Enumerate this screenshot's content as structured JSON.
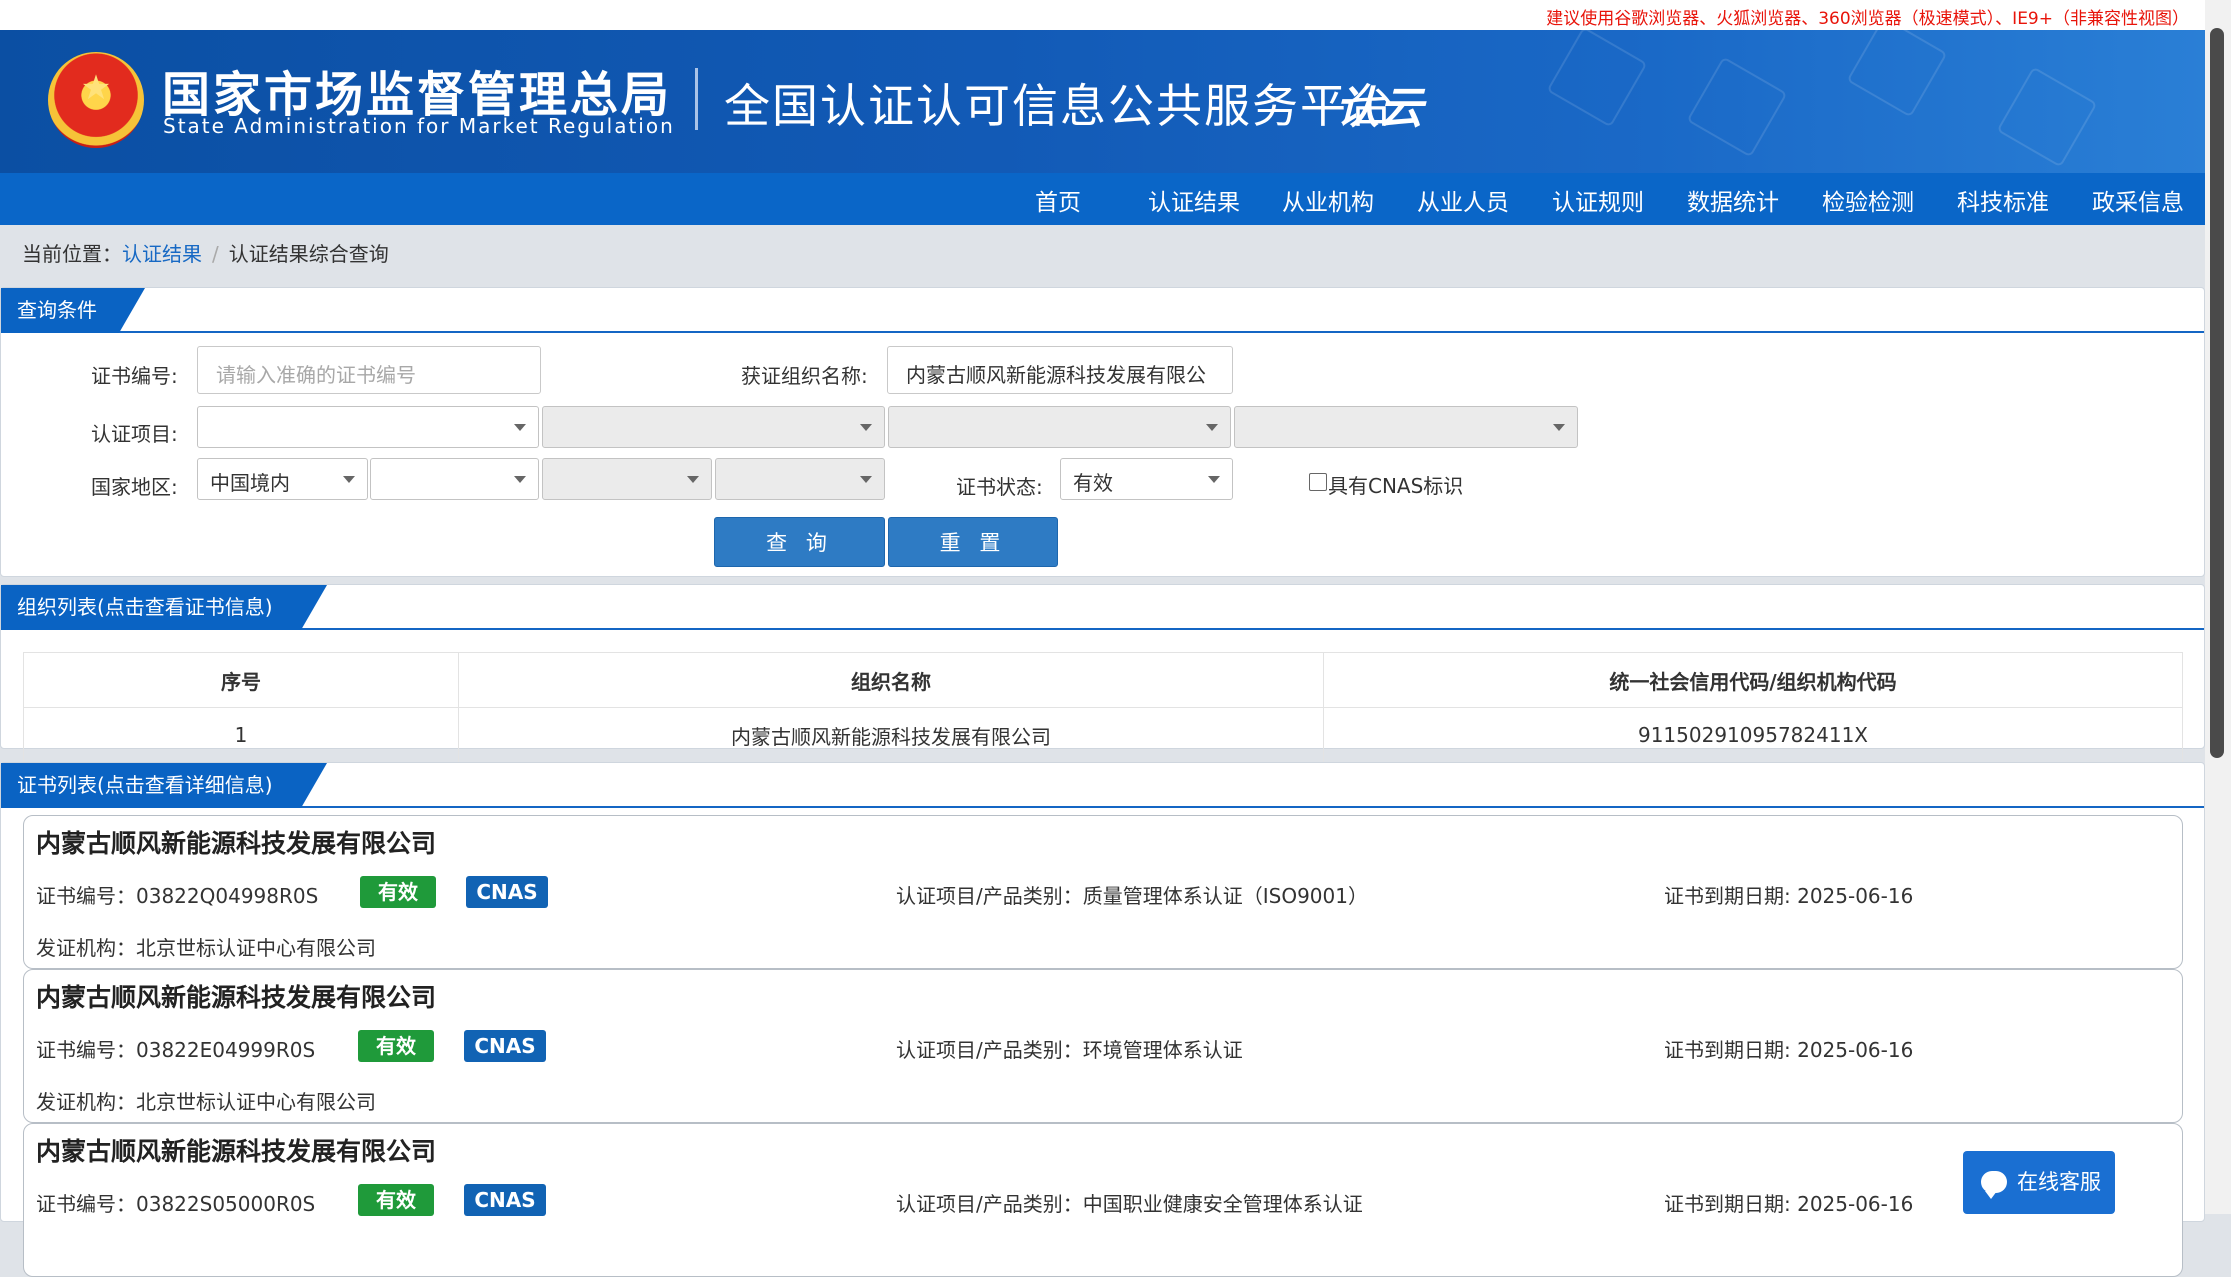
{
  "notice": "建议使用谷歌浏览器、火狐浏览器、360浏览器（极速模式）、IE9+（非兼容性视图）",
  "header": {
    "org_cn": "国家市场监督管理总局",
    "org_en": "State Administration for Market Regulation",
    "platform": "全国认证认可信息公共服务平台",
    "logo_text": "认云"
  },
  "nav": [
    "首页",
    "认证结果",
    "从业机构",
    "从业人员",
    "认证规则",
    "数据统计",
    "检验检测",
    "科技标准",
    "政采信息"
  ],
  "breadcrumb": {
    "prefix": "当前位置：",
    "link": "认证结果",
    "separator": "/",
    "current": "认证结果综合查询"
  },
  "query": {
    "title": "查询条件",
    "cert_no_label": "证书编号:",
    "cert_no_placeholder": "请输入准确的证书编号",
    "org_name_label": "获证组织名称:",
    "org_name_value": "内蒙古顺风新能源科技发展有限公",
    "project_label": "认证项目:",
    "region_label": "国家地区:",
    "region_value": "中国境内",
    "status_label": "证书状态:",
    "status_value": "有效",
    "cnas_checkbox_label": "具有CNAS标识",
    "search_button": "查 询",
    "reset_button": "重 置"
  },
  "org_list": {
    "title": "组织列表(点击查看证书信息)",
    "columns": [
      "序号",
      "组织名称",
      "统一社会信用代码/组织机构代码"
    ],
    "rows": [
      [
        "1",
        "内蒙古顺风新能源科技发展有限公司",
        "91150291095782411X"
      ]
    ]
  },
  "cert_list": {
    "title": "证书列表(点击查看详细信息)",
    "items": [
      {
        "org": "内蒙古顺风新能源科技发展有限公司",
        "cert_no": "证书编号：03822Q04998R0S",
        "status": "有效",
        "cnas": "CNAS",
        "project": "认证项目/产品类别：质量管理体系认证（ISO9001）",
        "expiry": "证书到期日期: 2025-06-16",
        "issuer": "发证机构：北京世标认证中心有限公司"
      },
      {
        "org": "内蒙古顺风新能源科技发展有限公司",
        "cert_no": "证书编号：03822E04999R0S",
        "status": "有效",
        "cnas": "CNAS",
        "project": "认证项目/产品类别：环境管理体系认证",
        "expiry": "证书到期日期: 2025-06-16",
        "issuer": "发证机构：北京世标认证中心有限公司"
      },
      {
        "org": "内蒙古顺风新能源科技发展有限公司",
        "cert_no": "证书编号：03822S05000R0S",
        "status": "有效",
        "cnas": "CNAS",
        "project": "认证项目/产品类别：中国职业健康安全管理体系认证",
        "expiry": "证书到期日期: 2025-06-16",
        "issuer": ""
      }
    ]
  },
  "chat_button": "在线客服",
  "colors": {
    "brand_blue": "#0a63c3",
    "valid_green": "#1f9a3a",
    "cnas_blue": "#1163b4",
    "notice_red": "#e8140a"
  }
}
